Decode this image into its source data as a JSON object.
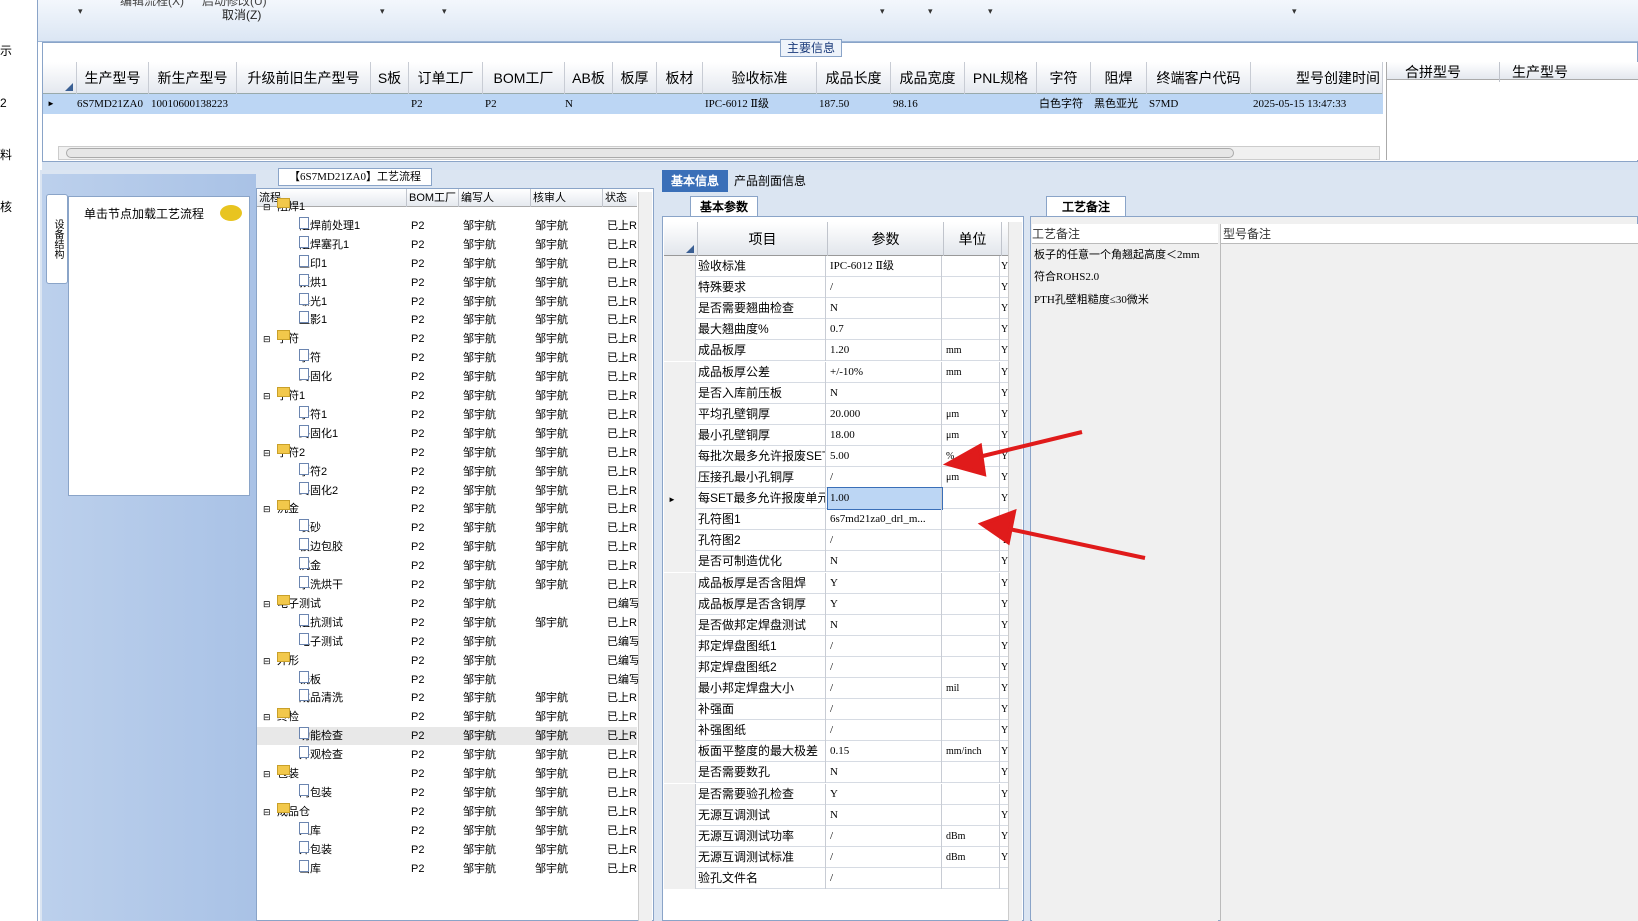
{
  "toolbar": {
    "cut_label": "编辑流程(X)",
    "undo_label": "启动修改(U)",
    "cancel_label": "取消(Z)"
  },
  "left_strip": [
    "示",
    "2",
    "料",
    "核"
  ],
  "main_section": {
    "label": "主要信息",
    "columns": [
      "生产型号",
      "新生产型号",
      "升级前旧生产型号",
      "S板",
      "订单工厂",
      "BOM工厂",
      "AB板",
      "板厚",
      "板材",
      "验收标准",
      "成品长度",
      "成品宽度",
      "PNL规格",
      "字符",
      "阻焊",
      "终端客户代码",
      "型号创建时间"
    ],
    "row": {
      "生产型号": "6S7MD21ZA0",
      "新生产型号": "10010600138223",
      "订单工厂": "P2",
      "BOM工厂": "P2",
      "AB板": "N",
      "验收标准": "IPC-6012 Ⅱ级",
      "成品长度": "187.50",
      "成品宽度": "98.16",
      "字符": "白色字符",
      "阻焊": "黑色亚光",
      "终端客户代码": "S7MD",
      "型号创建时间": "2025-05-15 13:47:33"
    },
    "right_columns": [
      "合拼型号",
      "生产型号"
    ]
  },
  "left_panel": {
    "vertical_tab": "设备结构",
    "node_hint": "单击节点加载工艺流程"
  },
  "flow": {
    "title": "【6S7MD21ZA0】工艺流程",
    "columns": [
      "流程",
      "BOM工厂",
      "编写人",
      "核审人",
      "状态"
    ],
    "rows": [
      {
        "type": "folder",
        "name": "阻焊1",
        "bom": "",
        "writer": "",
        "reviewer": "",
        "status": ""
      },
      {
        "type": "item",
        "name": "阻焊前处理1",
        "bom": "P2",
        "writer": "邹宇航",
        "reviewer": "邹宇航",
        "status": "已上R"
      },
      {
        "type": "item",
        "name": "阻焊塞孔1",
        "bom": "P2",
        "writer": "邹宇航",
        "reviewer": "邹宇航",
        "status": "已上R"
      },
      {
        "type": "item",
        "name": "丝印1",
        "bom": "P2",
        "writer": "邹宇航",
        "reviewer": "邹宇航",
        "status": "已上R"
      },
      {
        "type": "item",
        "name": "预烘1",
        "bom": "P2",
        "writer": "邹宇航",
        "reviewer": "邹宇航",
        "status": "已上R"
      },
      {
        "type": "item",
        "name": "曝光1",
        "bom": "P2",
        "writer": "邹宇航",
        "reviewer": "邹宇航",
        "status": "已上R"
      },
      {
        "type": "item",
        "name": "显影1",
        "bom": "P2",
        "writer": "邹宇航",
        "reviewer": "邹宇航",
        "status": "已上R"
      },
      {
        "type": "folder",
        "name": "字符",
        "bom": "P2",
        "writer": "邹宇航",
        "reviewer": "邹宇航",
        "status": "已上R"
      },
      {
        "type": "item",
        "name": "字符",
        "bom": "P2",
        "writer": "邹宇航",
        "reviewer": "邹宇航",
        "status": "已上R"
      },
      {
        "type": "item",
        "name": "终固化",
        "bom": "P2",
        "writer": "邹宇航",
        "reviewer": "邹宇航",
        "status": "已上R"
      },
      {
        "type": "folder",
        "name": "字符1",
        "bom": "P2",
        "writer": "邹宇航",
        "reviewer": "邹宇航",
        "status": "已上R"
      },
      {
        "type": "item",
        "name": "字符1",
        "bom": "P2",
        "writer": "邹宇航",
        "reviewer": "邹宇航",
        "status": "已上R"
      },
      {
        "type": "item",
        "name": "终固化1",
        "bom": "P2",
        "writer": "邹宇航",
        "reviewer": "邹宇航",
        "status": "已上R"
      },
      {
        "type": "folder",
        "name": "字符2",
        "bom": "P2",
        "writer": "邹宇航",
        "reviewer": "邹宇航",
        "status": "已上R"
      },
      {
        "type": "item",
        "name": "字符2",
        "bom": "P2",
        "writer": "邹宇航",
        "reviewer": "邹宇航",
        "status": "已上R"
      },
      {
        "type": "item",
        "name": "终固化2",
        "bom": "P2",
        "writer": "邹宇航",
        "reviewer": "邹宇航",
        "status": "已上R"
      },
      {
        "type": "folder",
        "name": "沉金",
        "bom": "P2",
        "writer": "邹宇航",
        "reviewer": "邹宇航",
        "status": "已上R"
      },
      {
        "type": "item",
        "name": "喷砂",
        "bom": "P2",
        "writer": "邹宇航",
        "reviewer": "邹宇航",
        "status": "已上R"
      },
      {
        "type": "item",
        "name": "板边包胶",
        "bom": "P2",
        "writer": "邹宇航",
        "reviewer": "邹宇航",
        "status": "已上R"
      },
      {
        "type": "item",
        "name": "沉金",
        "bom": "P2",
        "writer": "邹宇航",
        "reviewer": "邹宇航",
        "status": "已上R"
      },
      {
        "type": "item",
        "name": "水洗烘干",
        "bom": "P2",
        "writer": "邹宇航",
        "reviewer": "邹宇航",
        "status": "已上R"
      },
      {
        "type": "folder",
        "name": "电子测试",
        "bom": "P2",
        "writer": "邹宇航",
        "reviewer": "",
        "status": "已编写"
      },
      {
        "type": "item",
        "name": "阻抗测试",
        "bom": "P2",
        "writer": "邹宇航",
        "reviewer": "邹宇航",
        "status": "已上R"
      },
      {
        "type": "item",
        "name": "电子测试",
        "bom": "P2",
        "writer": "邹宇航",
        "reviewer": "",
        "status": "已编写"
      },
      {
        "type": "folder",
        "name": "外形",
        "bom": "P2",
        "writer": "邹宇航",
        "reviewer": "",
        "status": "已编写"
      },
      {
        "type": "item",
        "name": "铣板",
        "bom": "P2",
        "writer": "邹宇航",
        "reviewer": "",
        "status": "已编写"
      },
      {
        "type": "item",
        "name": "成品清洗",
        "bom": "P2",
        "writer": "邹宇航",
        "reviewer": "邹宇航",
        "status": "已上R"
      },
      {
        "type": "folder",
        "name": "终检",
        "bom": "P2",
        "writer": "邹宇航",
        "reviewer": "邹宇航",
        "status": "已上R"
      },
      {
        "type": "item",
        "name": "功能检查",
        "bom": "P2",
        "writer": "邹宇航",
        "reviewer": "邹宇航",
        "status": "已上R"
      },
      {
        "type": "item",
        "name": "外观检查",
        "bom": "P2",
        "writer": "邹宇航",
        "reviewer": "邹宇航",
        "status": "已上R"
      },
      {
        "type": "folder",
        "name": "包装",
        "bom": "P2",
        "writer": "邹宇航",
        "reviewer": "邹宇航",
        "status": "已上R"
      },
      {
        "type": "item",
        "name": "内包装",
        "bom": "P2",
        "writer": "邹宇航",
        "reviewer": "邹宇航",
        "status": "已上R"
      },
      {
        "type": "folder",
        "name": "成品仓",
        "bom": "P2",
        "writer": "邹宇航",
        "reviewer": "邹宇航",
        "status": "已上R"
      },
      {
        "type": "item",
        "name": "入库",
        "bom": "P2",
        "writer": "邹宇航",
        "reviewer": "邹宇航",
        "status": "已上R"
      },
      {
        "type": "item",
        "name": "外包装",
        "bom": "P2",
        "writer": "邹宇航",
        "reviewer": "邹宇航",
        "status": "已上R"
      },
      {
        "type": "item",
        "name": "出库",
        "bom": "P2",
        "writer": "邹宇航",
        "reviewer": "邹宇航",
        "status": "已上R"
      }
    ]
  },
  "tabs": {
    "basic": "基本信息",
    "profile": "产品剖面信息",
    "params": "基本参数",
    "remarks": "工艺备注"
  },
  "params": {
    "columns": [
      "项目",
      "参数",
      "单位"
    ],
    "rows": [
      [
        "验收标准",
        "IPC-6012 Ⅱ级",
        "",
        "Y"
      ],
      [
        "特殊要求",
        "/",
        "",
        "Y"
      ],
      [
        "是否需要翘曲检查",
        "N",
        "",
        "Y"
      ],
      [
        "最大翘曲度%",
        "0.7",
        "",
        "Y"
      ],
      [
        "成品板厚",
        "1.20",
        "mm",
        "Y"
      ],
      [
        "成品板厚公差",
        "+/-10%",
        "mm",
        "Y"
      ],
      [
        "是否入库前压板",
        "N",
        "",
        "Y"
      ],
      [
        "平均孔壁铜厚",
        "20.000",
        "μm",
        "Y"
      ],
      [
        "最小孔壁铜厚",
        "18.00",
        "μm",
        "Y"
      ],
      [
        "每批次最多允许报废SET",
        "5.00",
        "%",
        "Y"
      ],
      [
        "压接孔最小孔铜厚",
        "/",
        "μm",
        "Y"
      ],
      [
        "每SET最多允许报废单元",
        "1.00",
        "",
        "Y"
      ],
      [
        "孔符图1",
        "6s7md21za0_drl_m...",
        "",
        "Y"
      ],
      [
        "孔符图2",
        "/",
        "",
        "Y"
      ],
      [
        "是否可制造优化",
        "N",
        "",
        "Y"
      ],
      [
        "成品板厚是否含阻焊",
        "Y",
        "",
        "Y"
      ],
      [
        "成品板厚是否含铜厚",
        "Y",
        "",
        "Y"
      ],
      [
        "是否做邦定焊盘测试",
        "N",
        "",
        "Y"
      ],
      [
        "邦定焊盘图纸1",
        "/",
        "",
        "Y"
      ],
      [
        "邦定焊盘图纸2",
        "/",
        "",
        "Y"
      ],
      [
        "最小邦定焊盘大小",
        "/",
        "mil",
        "Y"
      ],
      [
        "补强面",
        "/",
        "",
        "Y"
      ],
      [
        "补强图纸",
        "/",
        "",
        "Y"
      ],
      [
        "板面平整度的最大极差",
        "0.15",
        "mm/inch",
        "Y"
      ],
      [
        "是否需要数孔",
        "N",
        "",
        "Y"
      ],
      [
        "是否需要验孔检查",
        "Y",
        "",
        "Y"
      ],
      [
        "无源互调测试",
        "N",
        "",
        "Y"
      ],
      [
        "无源互调测试功率",
        "/",
        "dBm",
        "Y"
      ],
      [
        "无源互调测试标准",
        "/",
        "dBm",
        "Y"
      ],
      [
        "验孔文件名",
        "/",
        "",
        ""
      ]
    ],
    "selected_index": 11
  },
  "remarks": {
    "left_header": "工艺备注",
    "right_header": "型号备注",
    "lines": [
      "板子的任意一个角翘起高度＜2mm",
      "符合ROHS2.0",
      "PTH孔壁粗糙度≤30微米"
    ]
  },
  "colors": {
    "accent": "#3a6fb8",
    "selection": "#bcd6f4",
    "arrow": "#e01b1b"
  }
}
